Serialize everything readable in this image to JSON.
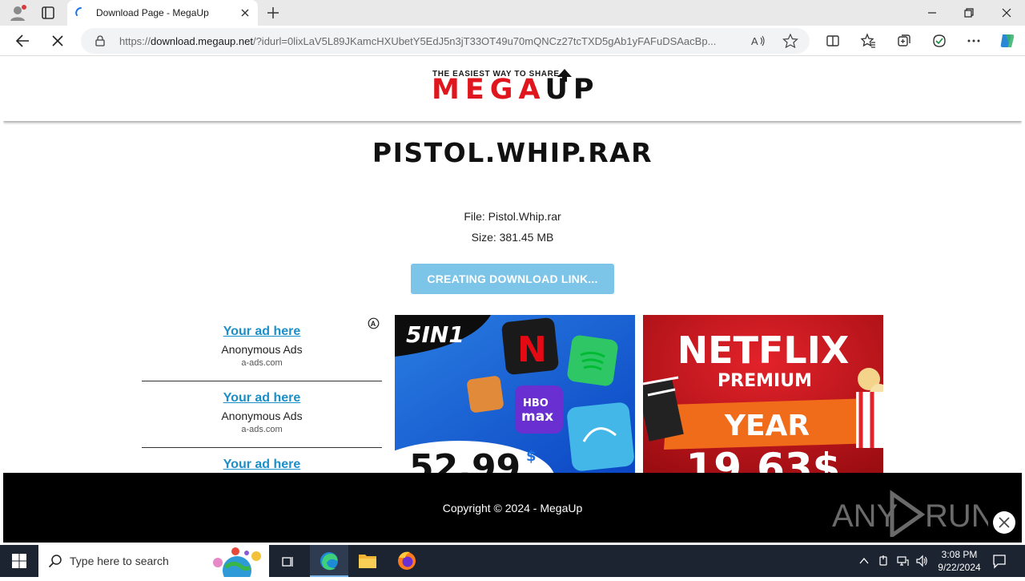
{
  "browser": {
    "tab_title": "Download Page - MegaUp",
    "url_scheme": "https://",
    "url_host": "download.megaup.net",
    "url_rest": "/?idurl=0lixLaV5L89JKamcHXUbetY5EdJ5n3jT33OT49u70mQNCz27tcTXD5gAb1yFAFuDSAacBp..."
  },
  "site": {
    "logo_tagline": "THE EASIEST WAY TO SHARE",
    "logo_text_red": "MEGA",
    "logo_text_black": "UP"
  },
  "file": {
    "title": "PISTOL.WHIP.RAR",
    "name_line": "File: Pistol.Whip.rar",
    "size_line": "Size: 381.45 MB",
    "button_label": "CREATING DOWNLOAD LINK..."
  },
  "ads": [
    {
      "link": "Your ad here",
      "name": "Anonymous Ads",
      "domain": "a-ads.com"
    },
    {
      "link": "Your ad here",
      "name": "Anonymous Ads",
      "domain": "a-ads.com"
    },
    {
      "link": "Your ad here",
      "name": "",
      "domain": ""
    }
  ],
  "banner1": {
    "badge": "5IN1",
    "price": "52.99",
    "currency": "$"
  },
  "banner2": {
    "line1": "NETFLIX",
    "line2": "PREMIUM",
    "line3": "YEAR",
    "price": "19.63$"
  },
  "footer": {
    "copyright": "Copyright © 2024 - MegaUp"
  },
  "watermark": {
    "left": "ANY",
    "right": "RUN"
  },
  "taskbar": {
    "search_placeholder": "Type here to search",
    "time": "3:08 PM",
    "date": "9/22/2024"
  },
  "colors": {
    "accent": "#1a8fc9",
    "button": "#7cc4e8",
    "brand_red": "#e0161e"
  }
}
